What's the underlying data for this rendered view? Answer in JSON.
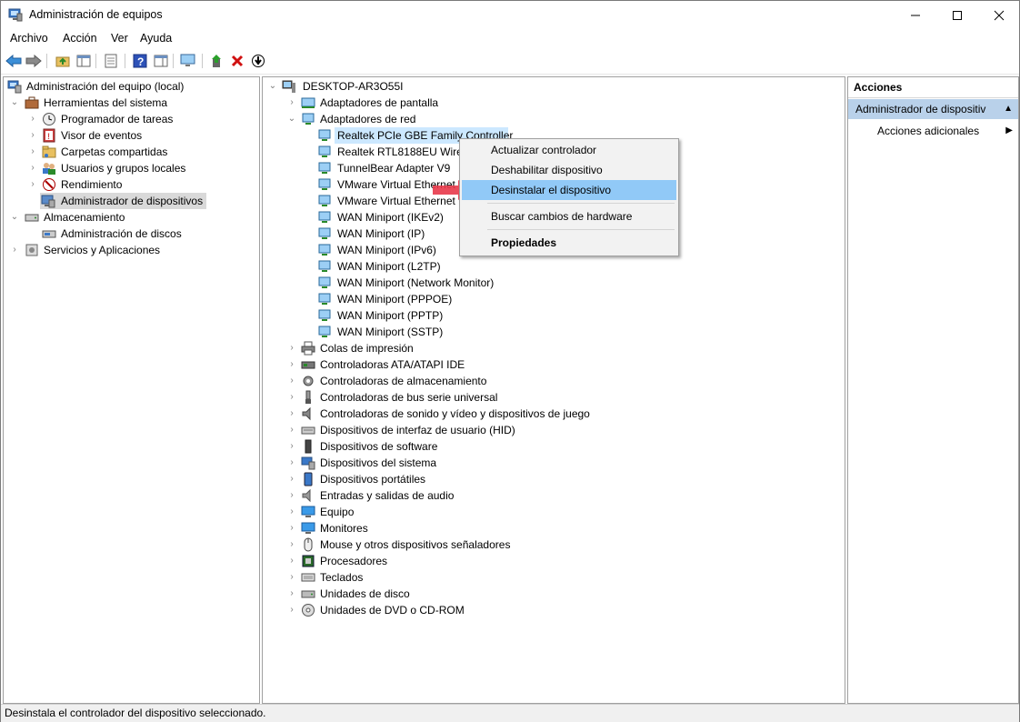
{
  "window": {
    "title": "Administración de equipos"
  },
  "menu": [
    "Archivo",
    "Acción",
    "Ver",
    "Ayuda"
  ],
  "left_tree": {
    "root": "Administración del equipo (local)",
    "system_tools": "Herramientas del sistema",
    "task_scheduler": "Programador de tareas",
    "event_viewer": "Visor de eventos",
    "shared_folders": "Carpetas compartidas",
    "local_users": "Usuarios y grupos locales",
    "performance": "Rendimiento",
    "device_manager": "Administrador de dispositivos",
    "storage": "Almacenamiento",
    "disk_management": "Administración de discos",
    "services_apps": "Servicios y Aplicaciones"
  },
  "device_tree": {
    "computer": "DESKTOP-AR3O55I",
    "display_adapters": "Adaptadores de pantalla",
    "network_adapters": "Adaptadores de red",
    "network_items": [
      "Realtek PCIe GBE Family Controller",
      "Realtek RTL8188EU Wirele",
      "TunnelBear Adapter V9",
      "VMware Virtual Ethernet",
      "VMware Virtual Ethernet",
      "WAN Miniport (IKEv2)",
      "WAN Miniport (IP)",
      "WAN Miniport (IPv6)",
      "WAN Miniport (L2TP)",
      "WAN Miniport (Network Monitor)",
      "WAN Miniport (PPPOE)",
      "WAN Miniport (PPTP)",
      "WAN Miniport (SSTP)"
    ],
    "categories": [
      "Colas de impresión",
      "Controladoras ATA/ATAPI IDE",
      "Controladoras de almacenamiento",
      "Controladoras de bus serie universal",
      "Controladoras de sonido y vídeo y dispositivos de juego",
      "Dispositivos de interfaz de usuario (HID)",
      "Dispositivos de software",
      "Dispositivos del sistema",
      "Dispositivos portátiles",
      "Entradas y salidas de audio",
      "Equipo",
      "Monitores",
      "Mouse y otros dispositivos señaladores",
      "Procesadores",
      "Teclados",
      "Unidades de disco",
      "Unidades de DVD o CD-ROM"
    ]
  },
  "context_menu": {
    "update_driver": "Actualizar controlador",
    "disable_device": "Deshabilitar dispositivo",
    "uninstall_device": "Desinstalar el dispositivo",
    "scan_hardware": "Buscar cambios de hardware",
    "properties": "Propiedades"
  },
  "actions_pane": {
    "header": "Acciones",
    "group": "Administrador de dispositiv",
    "more_actions": "Acciones adicionales"
  },
  "status": {
    "text": "Desinstala el controlador del dispositivo seleccionado."
  },
  "colors": {
    "selection": "#cce8ff",
    "menu_highlight": "#91c9f7",
    "actions_group": "#b9d1ea",
    "arrow_red": "#e8394a"
  }
}
